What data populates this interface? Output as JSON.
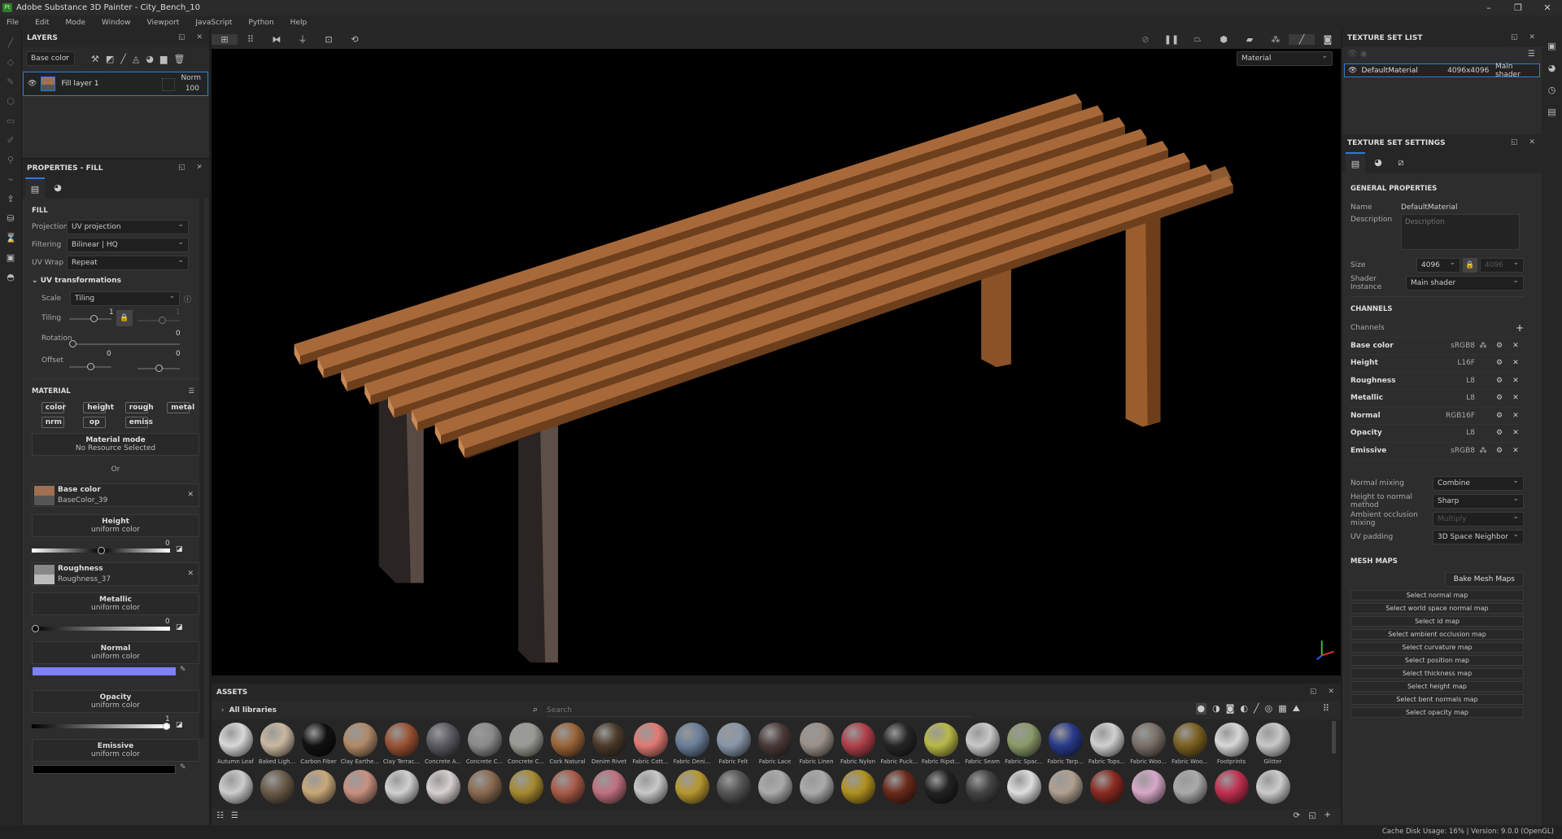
{
  "window": {
    "title": "Adobe Substance 3D Painter - City_Bench_10",
    "controls": [
      "–",
      "❐",
      "✕"
    ]
  },
  "menu": [
    "File",
    "Edit",
    "Mode",
    "Window",
    "Viewport",
    "JavaScript",
    "Python",
    "Help"
  ],
  "layers": {
    "title": "LAYERS",
    "channel": "Base color",
    "layer_name": "Fill layer 1",
    "blend": "Norm",
    "opacity": "100"
  },
  "properties": {
    "title": "PROPERTIES - FILL",
    "fill_label": "FILL",
    "projection_label": "Projection",
    "projection": "UV projection",
    "filtering_label": "Filtering",
    "filtering": "Bilinear | HQ",
    "uvwrap_label": "UV Wrap",
    "uvwrap": "Repeat",
    "uvt_label": "UV transformations",
    "scale_label": "Scale",
    "scale": "Tiling",
    "tiling_label": "Tiling",
    "tiling_u": "1",
    "tiling_v": "1",
    "rotation_label": "Rotation",
    "rotation": "0",
    "offset_label": "Offset",
    "offset_u": "0",
    "offset_v": "0",
    "material_label": "MATERIAL",
    "chips": [
      "color",
      "height",
      "rough",
      "metal",
      "nrm",
      "op",
      "emiss"
    ],
    "material_mode": "Material mode",
    "no_resource": "No Resource Selected",
    "or": "Or",
    "base_color": {
      "label": "Base color",
      "resource": "BaseColor_39",
      "color": "#a07050"
    },
    "height": {
      "label": "Height",
      "sub": "uniform color",
      "value": "0",
      "level": 0.5
    },
    "roughness": {
      "label": "Roughness",
      "resource": "Roughness_37"
    },
    "metallic": {
      "label": "Metallic",
      "sub": "uniform color",
      "value": "0",
      "level": 0
    },
    "normal": {
      "label": "Normal",
      "sub": "uniform color",
      "color": "#7f7fff"
    },
    "opacity": {
      "label": "Opacity",
      "sub": "uniform color",
      "value": "1",
      "level": 1
    },
    "emissive": {
      "label": "Emissive",
      "sub": "uniform color",
      "color": "#000000"
    }
  },
  "viewport": {
    "mode": "Material"
  },
  "assets": {
    "title": "ASSETS",
    "library": "All libraries",
    "search_placeholder": "Search",
    "row1": [
      {
        "name": "Autumn Leaf",
        "color": "#d8d8d8"
      },
      {
        "name": "Baked Ligh...",
        "color": "#c9b8a0"
      },
      {
        "name": "Carbon Fiber",
        "color": "#111111"
      },
      {
        "name": "Clay Earthe...",
        "color": "#b08a68"
      },
      {
        "name": "Clay Terrac...",
        "color": "#9a5234"
      },
      {
        "name": "Concrete A...",
        "color": "#5a5a62"
      },
      {
        "name": "Concrete C...",
        "color": "#8a8a8a"
      },
      {
        "name": "Concrete C...",
        "color": "#9a9a94"
      },
      {
        "name": "Cork Natural",
        "color": "#9a6438"
      },
      {
        "name": "Denim Rivet",
        "color": "#4a3a2a"
      },
      {
        "name": "Fabric Cott...",
        "color": "#e07a74"
      },
      {
        "name": "Fabric Deni...",
        "color": "#6a7e98"
      },
      {
        "name": "Fabric Felt",
        "color": "#8896a8"
      },
      {
        "name": "Fabric Lace",
        "color": "#4a3a38"
      },
      {
        "name": "Fabric Linen",
        "color": "#9a9088"
      },
      {
        "name": "Fabric Nylon",
        "color": "#b0404a"
      },
      {
        "name": "Fabric Puck...",
        "color": "#262626"
      },
      {
        "name": "Fabric Ripst...",
        "color": "#b8b848"
      },
      {
        "name": "Fabric Seam",
        "color": "#c8c8c8"
      },
      {
        "name": "Fabric Spac...",
        "color": "#8a9a68"
      },
      {
        "name": "Fabric Tarp...",
        "color": "#2a3a8a"
      },
      {
        "name": "Fabric Tops...",
        "color": "#d0d0d0"
      },
      {
        "name": "Fabric Woo...",
        "color": "#7a7068"
      },
      {
        "name": "Fabric Woo...",
        "color": "#7a6020"
      },
      {
        "name": "Footprints",
        "color": "#d8d8d8"
      },
      {
        "name": "Glitter",
        "color": "#c8c8c8"
      }
    ],
    "row2": [
      "#cccccc",
      "#6a5a48",
      "#c8a878",
      "#c89080",
      "#d0d0d0",
      "#d8d0d0",
      "#8a6a50",
      "#a88a30",
      "#a85a48",
      "#c07080",
      "#c8c8c8",
      "#b89830",
      "#555555",
      "#aaaaaa",
      "#aaaaaa",
      "#b09020",
      "#6a2a1a",
      "#222222",
      "#444444",
      "#dddddd",
      "#b0a090",
      "#8a2a20",
      "#d8a8c8",
      "#aaaaaa",
      "#c03050",
      "#cccccc"
    ]
  },
  "texture_set_list": {
    "title": "TEXTURE SET LIST",
    "name": "DefaultMaterial",
    "size": "4096x4096",
    "shader": "Main shader"
  },
  "texture_set_settings": {
    "title": "TEXTURE SET SETTINGS",
    "general": "GENERAL PROPERTIES",
    "name_label": "Name",
    "name": "DefaultMaterial",
    "desc_label": "Description",
    "desc_placeholder": "Description",
    "size_label": "Size",
    "size": "4096",
    "size_locked": "4096",
    "shader_label": "Shader Instance",
    "shader": "Main shader",
    "channels_title": "CHANNELS",
    "channels_label": "Channels",
    "channels": [
      {
        "name": "Base color",
        "format": "sRGB8",
        "multi": true
      },
      {
        "name": "Height",
        "format": "L16F"
      },
      {
        "name": "Roughness",
        "format": "L8"
      },
      {
        "name": "Metallic",
        "format": "L8"
      },
      {
        "name": "Normal",
        "format": "RGB16F"
      },
      {
        "name": "Opacity",
        "format": "L8"
      },
      {
        "name": "Emissive",
        "format": "sRGB8",
        "multi": true
      }
    ],
    "options": [
      {
        "label": "Normal mixing",
        "value": "Combine"
      },
      {
        "label": "Height to normal method",
        "value": "Sharp"
      },
      {
        "label": "Ambient occlusion mixing",
        "value": "Multiply",
        "disabled": true
      },
      {
        "label": "UV padding",
        "value": "3D Space Neighbor"
      }
    ],
    "mesh_maps_title": "MESH MAPS",
    "bake": "Bake Mesh Maps",
    "mesh_maps": [
      "Select normal map",
      "Select world space normal map",
      "Select id map",
      "Select ambient occlusion map",
      "Select curvature map",
      "Select position map",
      "Select thickness map",
      "Select height map",
      "Select bent normals map",
      "Select opacity map"
    ]
  },
  "status": "Cache Disk Usage:   16% | Version: 9.0.0 (OpenGL)"
}
